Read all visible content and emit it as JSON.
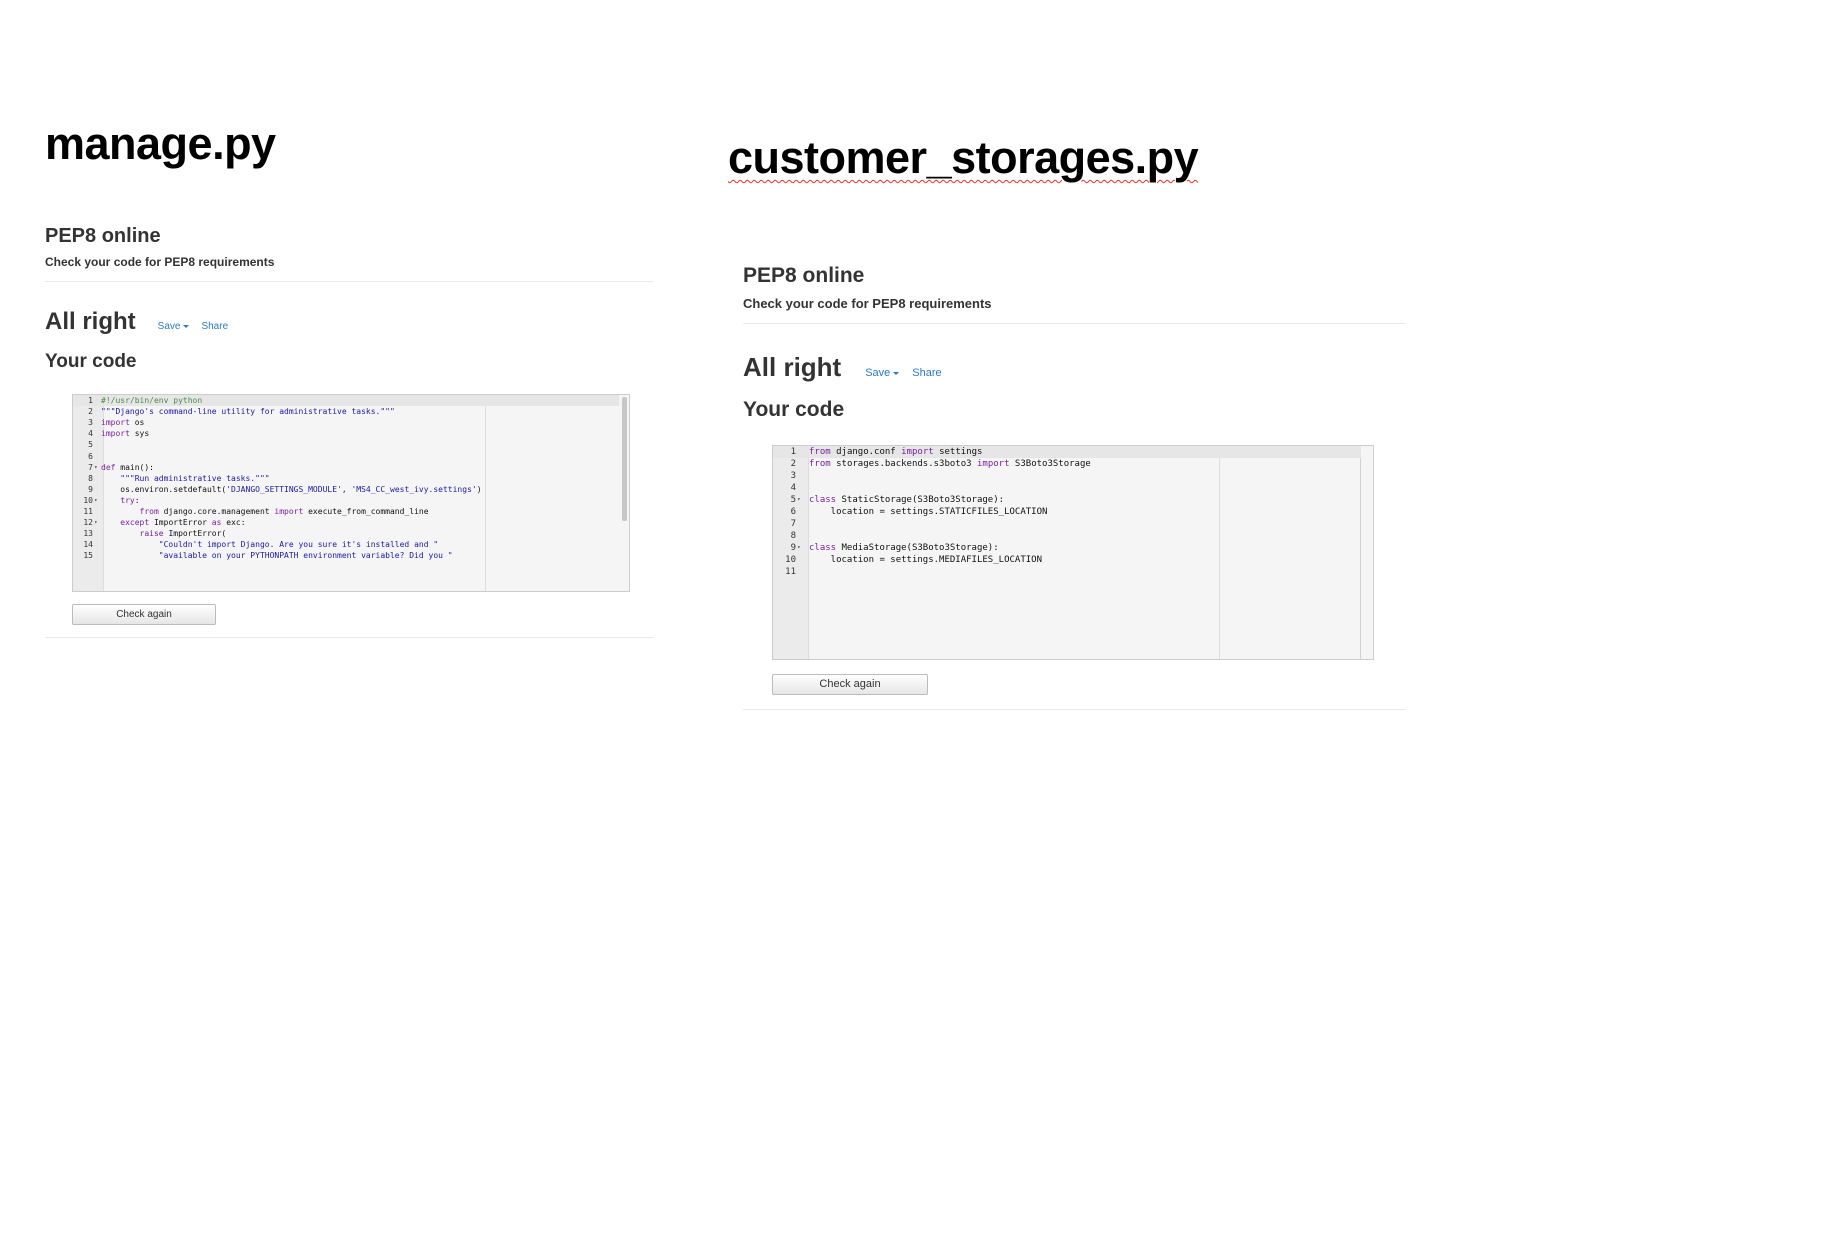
{
  "left": {
    "doc_title": "manage.py",
    "site_title": "PEP8 online",
    "site_subtitle": "Check your code for PEP8 requirements",
    "result_title": "All right",
    "save_label": "Save",
    "share_label": "Share",
    "your_code_label": "Your code",
    "check_again_label": "Check again",
    "lines": [
      {
        "n": "1",
        "fold": "",
        "tokens": [
          {
            "t": "#!/usr/bin/env python",
            "c": "cmt"
          }
        ]
      },
      {
        "n": "2",
        "fold": "",
        "tokens": [
          {
            "t": "\"\"\"Django's command-line utility for administrative tasks.\"\"\"",
            "c": "str"
          }
        ]
      },
      {
        "n": "3",
        "fold": "",
        "tokens": [
          {
            "t": "import",
            "c": "kw"
          },
          {
            "t": " os",
            "c": ""
          }
        ]
      },
      {
        "n": "4",
        "fold": "",
        "tokens": [
          {
            "t": "import",
            "c": "kw"
          },
          {
            "t": " sys",
            "c": ""
          }
        ]
      },
      {
        "n": "5",
        "fold": "",
        "tokens": []
      },
      {
        "n": "6",
        "fold": "",
        "tokens": []
      },
      {
        "n": "7",
        "fold": "▾",
        "tokens": [
          {
            "t": "def",
            "c": "kw"
          },
          {
            "t": " main():",
            "c": ""
          }
        ]
      },
      {
        "n": "8",
        "fold": "",
        "tokens": [
          {
            "t": "    ",
            "c": ""
          },
          {
            "t": "\"\"\"Run administrative tasks.\"\"\"",
            "c": "str"
          }
        ]
      },
      {
        "n": "9",
        "fold": "",
        "tokens": [
          {
            "t": "    os.environ.setdefault(",
            "c": ""
          },
          {
            "t": "'DJANGO_SETTINGS_MODULE'",
            "c": "str"
          },
          {
            "t": ", ",
            "c": ""
          },
          {
            "t": "'MS4_CC_west_ivy.settings'",
            "c": "str"
          },
          {
            "t": ")",
            "c": ""
          }
        ]
      },
      {
        "n": "10",
        "fold": "▾",
        "tokens": [
          {
            "t": "    ",
            "c": ""
          },
          {
            "t": "try",
            "c": "kw"
          },
          {
            "t": ":",
            "c": ""
          }
        ]
      },
      {
        "n": "11",
        "fold": "",
        "tokens": [
          {
            "t": "        ",
            "c": ""
          },
          {
            "t": "from",
            "c": "kw"
          },
          {
            "t": " django.core.management ",
            "c": ""
          },
          {
            "t": "import",
            "c": "kw"
          },
          {
            "t": " execute_from_command_line",
            "c": ""
          }
        ]
      },
      {
        "n": "12",
        "fold": "▾",
        "tokens": [
          {
            "t": "    ",
            "c": ""
          },
          {
            "t": "except",
            "c": "kw"
          },
          {
            "t": " ImportError ",
            "c": ""
          },
          {
            "t": "as",
            "c": "kw"
          },
          {
            "t": " exc:",
            "c": ""
          }
        ]
      },
      {
        "n": "13",
        "fold": "",
        "tokens": [
          {
            "t": "        ",
            "c": ""
          },
          {
            "t": "raise",
            "c": "kw"
          },
          {
            "t": " ImportError(",
            "c": ""
          }
        ]
      },
      {
        "n": "14",
        "fold": "",
        "tokens": [
          {
            "t": "            ",
            "c": ""
          },
          {
            "t": "\"Couldn't import Django. Are you sure it's installed and \"",
            "c": "str"
          }
        ]
      },
      {
        "n": "15",
        "fold": "",
        "tokens": [
          {
            "t": "            ",
            "c": ""
          },
          {
            "t": "\"available on your PYTHONPATH environment variable? Did you \"",
            "c": "str"
          }
        ]
      }
    ]
  },
  "right": {
    "doc_title": "customer_storages.py",
    "site_title": "PEP8 online",
    "site_subtitle": "Check your code for PEP8 requirements",
    "result_title": "All right",
    "save_label": "Save",
    "share_label": "Share",
    "your_code_label": "Your code",
    "check_again_label": "Check again",
    "lines": [
      {
        "n": "1",
        "fold": "",
        "tokens": [
          {
            "t": "from",
            "c": "kw"
          },
          {
            "t": " django.conf ",
            "c": ""
          },
          {
            "t": "import",
            "c": "kw"
          },
          {
            "t": " settings",
            "c": ""
          }
        ]
      },
      {
        "n": "2",
        "fold": "",
        "tokens": [
          {
            "t": "from",
            "c": "kw"
          },
          {
            "t": " storages.backends.s3boto3 ",
            "c": ""
          },
          {
            "t": "import",
            "c": "kw"
          },
          {
            "t": " S3Boto3Storage",
            "c": ""
          }
        ]
      },
      {
        "n": "3",
        "fold": "",
        "tokens": []
      },
      {
        "n": "4",
        "fold": "",
        "tokens": []
      },
      {
        "n": "5",
        "fold": "▾",
        "tokens": [
          {
            "t": "class",
            "c": "kw"
          },
          {
            "t": " StaticStorage(S3Boto3Storage):",
            "c": ""
          }
        ]
      },
      {
        "n": "6",
        "fold": "",
        "tokens": [
          {
            "t": "    location = settings.STATICFILES_LOCATION",
            "c": ""
          }
        ]
      },
      {
        "n": "7",
        "fold": "",
        "tokens": []
      },
      {
        "n": "8",
        "fold": "",
        "tokens": []
      },
      {
        "n": "9",
        "fold": "▾",
        "tokens": [
          {
            "t": "class",
            "c": "kw"
          },
          {
            "t": " MediaStorage(S3Boto3Storage):",
            "c": ""
          }
        ]
      },
      {
        "n": "10",
        "fold": "",
        "tokens": [
          {
            "t": "    location = settings.MEDIAFILES_LOCATION",
            "c": ""
          }
        ]
      },
      {
        "n": "11",
        "fold": "",
        "tokens": []
      }
    ]
  },
  "colors": {
    "keyword": "#7a1fa2",
    "string": "#1a1aa6",
    "comment": "#4a8a4a",
    "link": "#2a7bc4"
  }
}
